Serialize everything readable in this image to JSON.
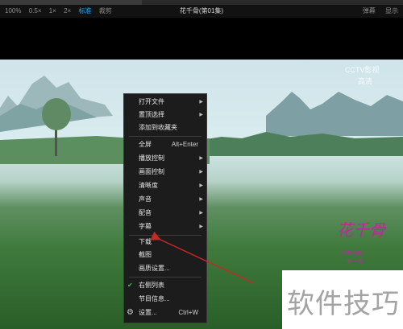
{
  "toolbar": {
    "zoom_100": "100%",
    "zoom_05": "0.5×",
    "zoom_1": "1×",
    "zoom_2": "2×",
    "standard": "标准",
    "crop": "裁剪",
    "title": "花千骨(第01集)",
    "danmaku": "弹幕",
    "more": "显示"
  },
  "video": {
    "channel_logo": "CCTV影视",
    "channel_sub": "高清",
    "show_logo": "花千骨",
    "show_sub": "三生池边",
    "show_sub2": "第一集"
  },
  "menu": {
    "open_file": "打开文件",
    "top_select": "置顶选择",
    "add_fav": "添加到收藏夹",
    "fullscreen": "全屏",
    "fullscreen_key": "Alt+Enter",
    "play_control": "播放控制",
    "screen_control": "画面控制",
    "clarity": "清晰度",
    "audio": "声音",
    "dub": "配音",
    "subtitle": "字幕",
    "download": "下载",
    "screenshot": "截图",
    "quality_settings": "画质设置...",
    "right_list": "右侧列表",
    "program_info": "节目信息...",
    "settings": "设置...",
    "settings_key": "Ctrl+W"
  },
  "badge": {
    "text": "软件技巧"
  },
  "colors": {
    "accent": "#2ea8e8",
    "check": "#3cbf5b",
    "annotation": "#c62828",
    "show_logo": "#c0269b"
  }
}
